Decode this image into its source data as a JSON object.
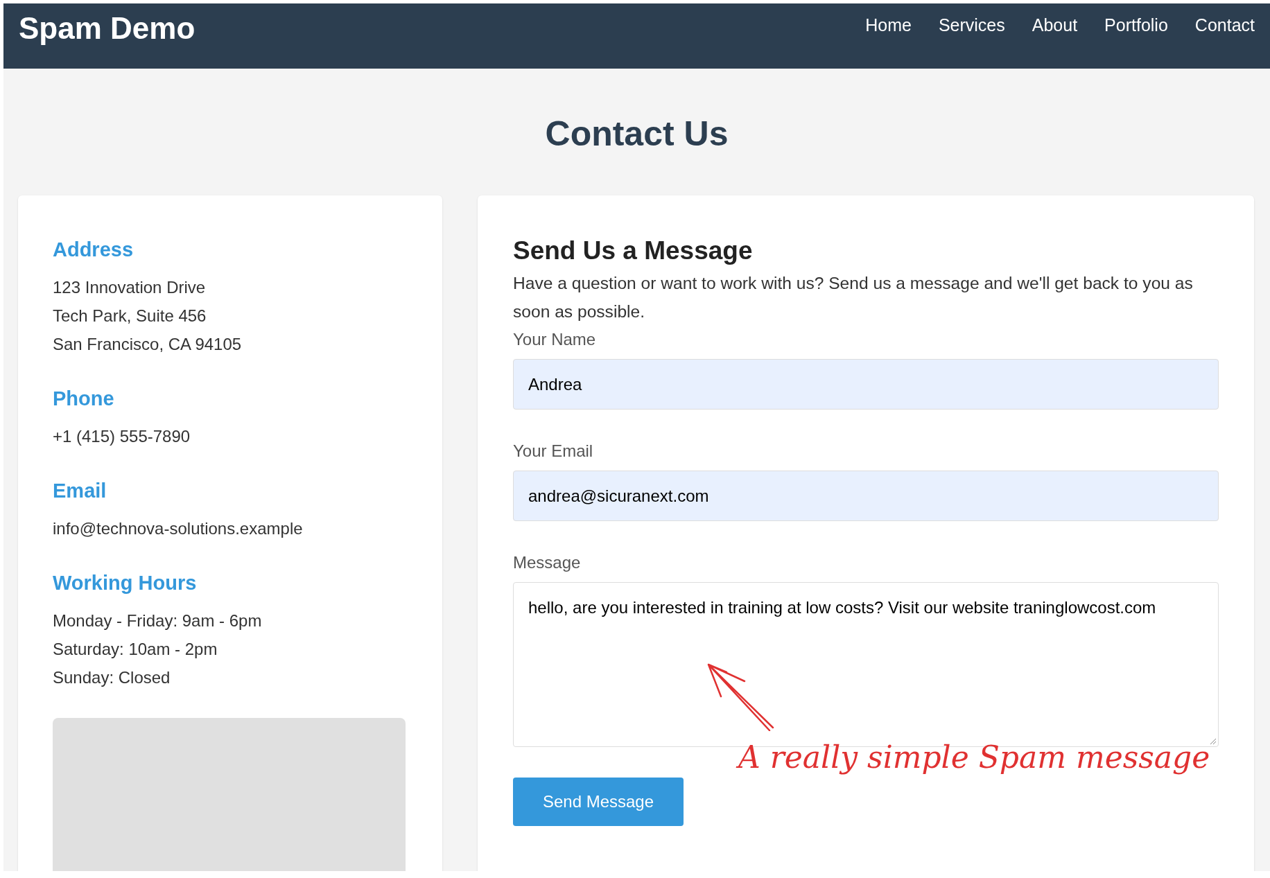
{
  "header": {
    "brand": "Spam Demo",
    "nav": [
      {
        "label": "Home"
      },
      {
        "label": "Services"
      },
      {
        "label": "About"
      },
      {
        "label": "Portfolio"
      },
      {
        "label": "Contact"
      }
    ]
  },
  "page_title": "Contact Us",
  "info": [
    {
      "heading": "Address",
      "lines": [
        "123 Innovation Drive",
        "Tech Park, Suite 456",
        "San Francisco, CA 94105"
      ]
    },
    {
      "heading": "Phone",
      "lines": [
        "+1 (415) 555-7890"
      ]
    },
    {
      "heading": "Email",
      "lines": [
        "info@technova-solutions.example"
      ]
    },
    {
      "heading": "Working Hours",
      "lines": [
        "Monday - Friday: 9am - 6pm",
        "Saturday: 10am - 2pm",
        "Sunday: Closed"
      ]
    }
  ],
  "form": {
    "title": "Send Us a Message",
    "intro": "Have a question or want to work with us? Send us a message and we'll get back to you as soon as possible.",
    "fields": [
      {
        "kind": "input",
        "label": "Your Name",
        "value": "Andrea",
        "autofilled": true
      },
      {
        "kind": "input",
        "label": "Your Email",
        "value": "andrea@sicuranext.com",
        "autofilled": true
      },
      {
        "kind": "textarea",
        "label": "Message",
        "value": "hello, are you interested in training at low costs? Visit our website traninglowcost.com",
        "autofilled": false
      }
    ],
    "submit": "Send Message"
  },
  "annotation": "A really simple Spam message"
}
